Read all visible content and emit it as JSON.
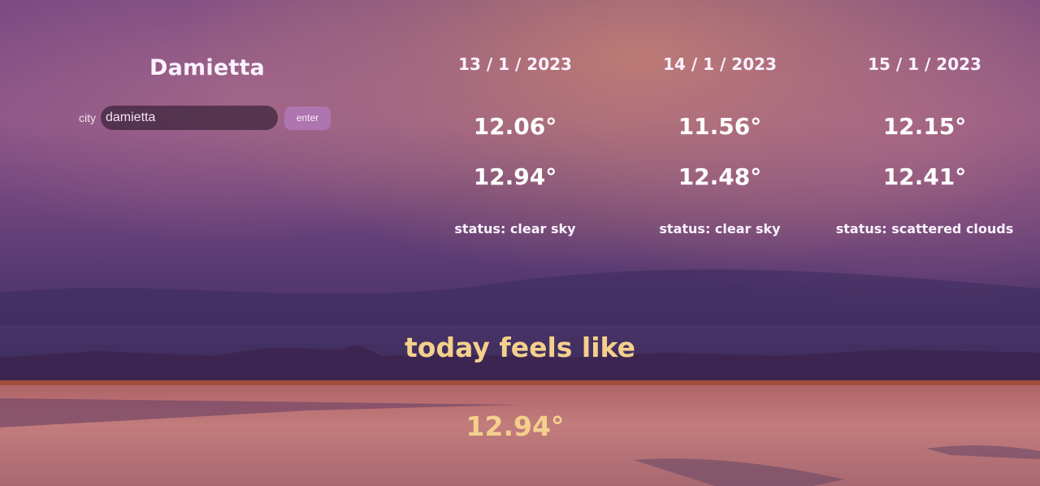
{
  "location": {
    "city_name": "Damietta"
  },
  "search": {
    "label": "city",
    "value": "damietta",
    "button_label": "enter"
  },
  "forecast": [
    {
      "date": "13 / 1 / 2023",
      "temp_max": "12.06°",
      "temp_min": "12.94°",
      "status": "status: clear sky"
    },
    {
      "date": "14 / 1 / 2023",
      "temp_max": "11.56°",
      "temp_min": "12.48°",
      "status": "status: clear sky"
    },
    {
      "date": "15 / 1 / 2023",
      "temp_max": "12.15°",
      "temp_min": "12.41°",
      "status": "status: scattered clouds"
    }
  ],
  "today": {
    "title": "today feels like",
    "value": "12.94°"
  },
  "colors": {
    "accent": "#f4d08c",
    "text": "#fbf2ff",
    "button": "#b27abc"
  }
}
